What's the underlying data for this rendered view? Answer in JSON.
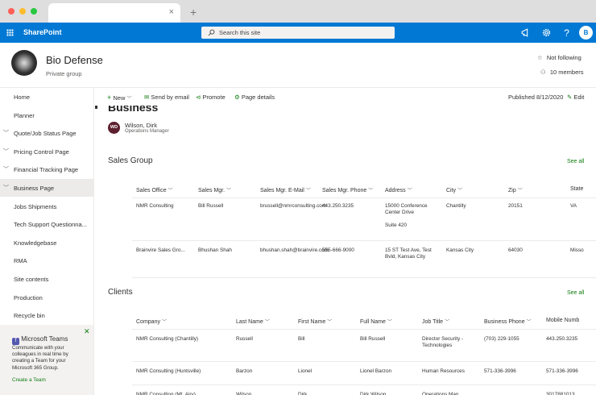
{
  "browser": {
    "tab_close": "×",
    "new_tab": "+"
  },
  "suite": {
    "brand": "SharePoint",
    "search_placeholder": "Search this site",
    "avatar": "B"
  },
  "site": {
    "title": "Bio Defense",
    "subtitle": "Private group",
    "follow": "Not following",
    "members": "10 members"
  },
  "nav": {
    "items": [
      {
        "label": "Home",
        "expand": false,
        "selected": false
      },
      {
        "label": "Planner",
        "expand": false,
        "selected": false
      },
      {
        "label": "Quote/Job Status Page",
        "expand": true,
        "selected": false
      },
      {
        "label": "Pricing Control Page",
        "expand": true,
        "selected": false
      },
      {
        "label": "Financial Tracking Page",
        "expand": true,
        "selected": false
      },
      {
        "label": "Business Page",
        "expand": true,
        "selected": true
      },
      {
        "label": "Jobs Shipments",
        "expand": false,
        "selected": false
      },
      {
        "label": "Tech Support Questionna...",
        "expand": false,
        "selected": false
      },
      {
        "label": "Knowledgebase",
        "expand": false,
        "selected": false
      },
      {
        "label": "RMA",
        "expand": false,
        "selected": false
      },
      {
        "label": "Site contents",
        "expand": false,
        "selected": false
      },
      {
        "label": "Production",
        "expand": false,
        "selected": false
      },
      {
        "label": "Recycle bin",
        "expand": false,
        "selected": false
      }
    ]
  },
  "teams": {
    "title": "Microsoft Teams",
    "description": "Communicate with your colleagues in real time by creating a Team for your Microsoft 365 Group.",
    "link": "Create a Team"
  },
  "commands": {
    "new": "New",
    "send": "Send by email",
    "promote": "Promote",
    "details": "Page details",
    "published": "Published 8/12/2020",
    "edit": "Edit"
  },
  "page": {
    "title": "Business",
    "author_initials": "WD",
    "author_name": "Wilson, Dirk",
    "author_role": "Operations Manager"
  },
  "sales": {
    "title": "Sales Group",
    "see_all": "See all",
    "headers": [
      "Sales Office",
      "Sales Mgr.",
      "Sales Mgr. E-Mail",
      "Sales Mgr. Phone",
      "Address",
      "City",
      "Zip",
      "State"
    ],
    "rows": [
      [
        "NMR Consulting",
        "Bill Russell",
        "brussell@nmrconsulting.com",
        "443.250.3235",
        "15000 Conference Center Drive\n\nSuite 420",
        "Chantilly",
        "20151",
        "VA"
      ],
      [
        "Brainvire Sales Gro...",
        "Bhushan Shah",
        "bhushan.shah@brainvire.com",
        "555-666-9000",
        "15 ST Test Ave, Test Bvld, Kansas City",
        "Kansas City",
        "64030",
        "Misso"
      ]
    ]
  },
  "clients": {
    "title": "Clients",
    "see_all": "See all",
    "headers": [
      "Company",
      "Last Name",
      "First Name",
      "Full Name",
      "Job Title",
      "Business Phone",
      "Mobile Numb"
    ],
    "rows": [
      [
        "NMR Consulting (Chantilly)",
        "Russell",
        "Bill",
        "Bill Russell",
        "Director Security - Technologies",
        "(703) 229-1055",
        "443.250.3235"
      ],
      [
        "NMR Consulting (Huntsville)",
        "Barzon",
        "Lionel",
        "Lionel Barzon",
        "Human Resources",
        "571-336-3996",
        "571-336-3996"
      ],
      [
        "NMR Consulting (Mt. Airy)",
        "Wilson",
        "Dirk",
        "Dirk Wilson",
        "Operations Man...",
        "",
        "3017881013"
      ]
    ]
  },
  "colors": {
    "suite": "#0078d4",
    "accent_green": "#107c10"
  }
}
